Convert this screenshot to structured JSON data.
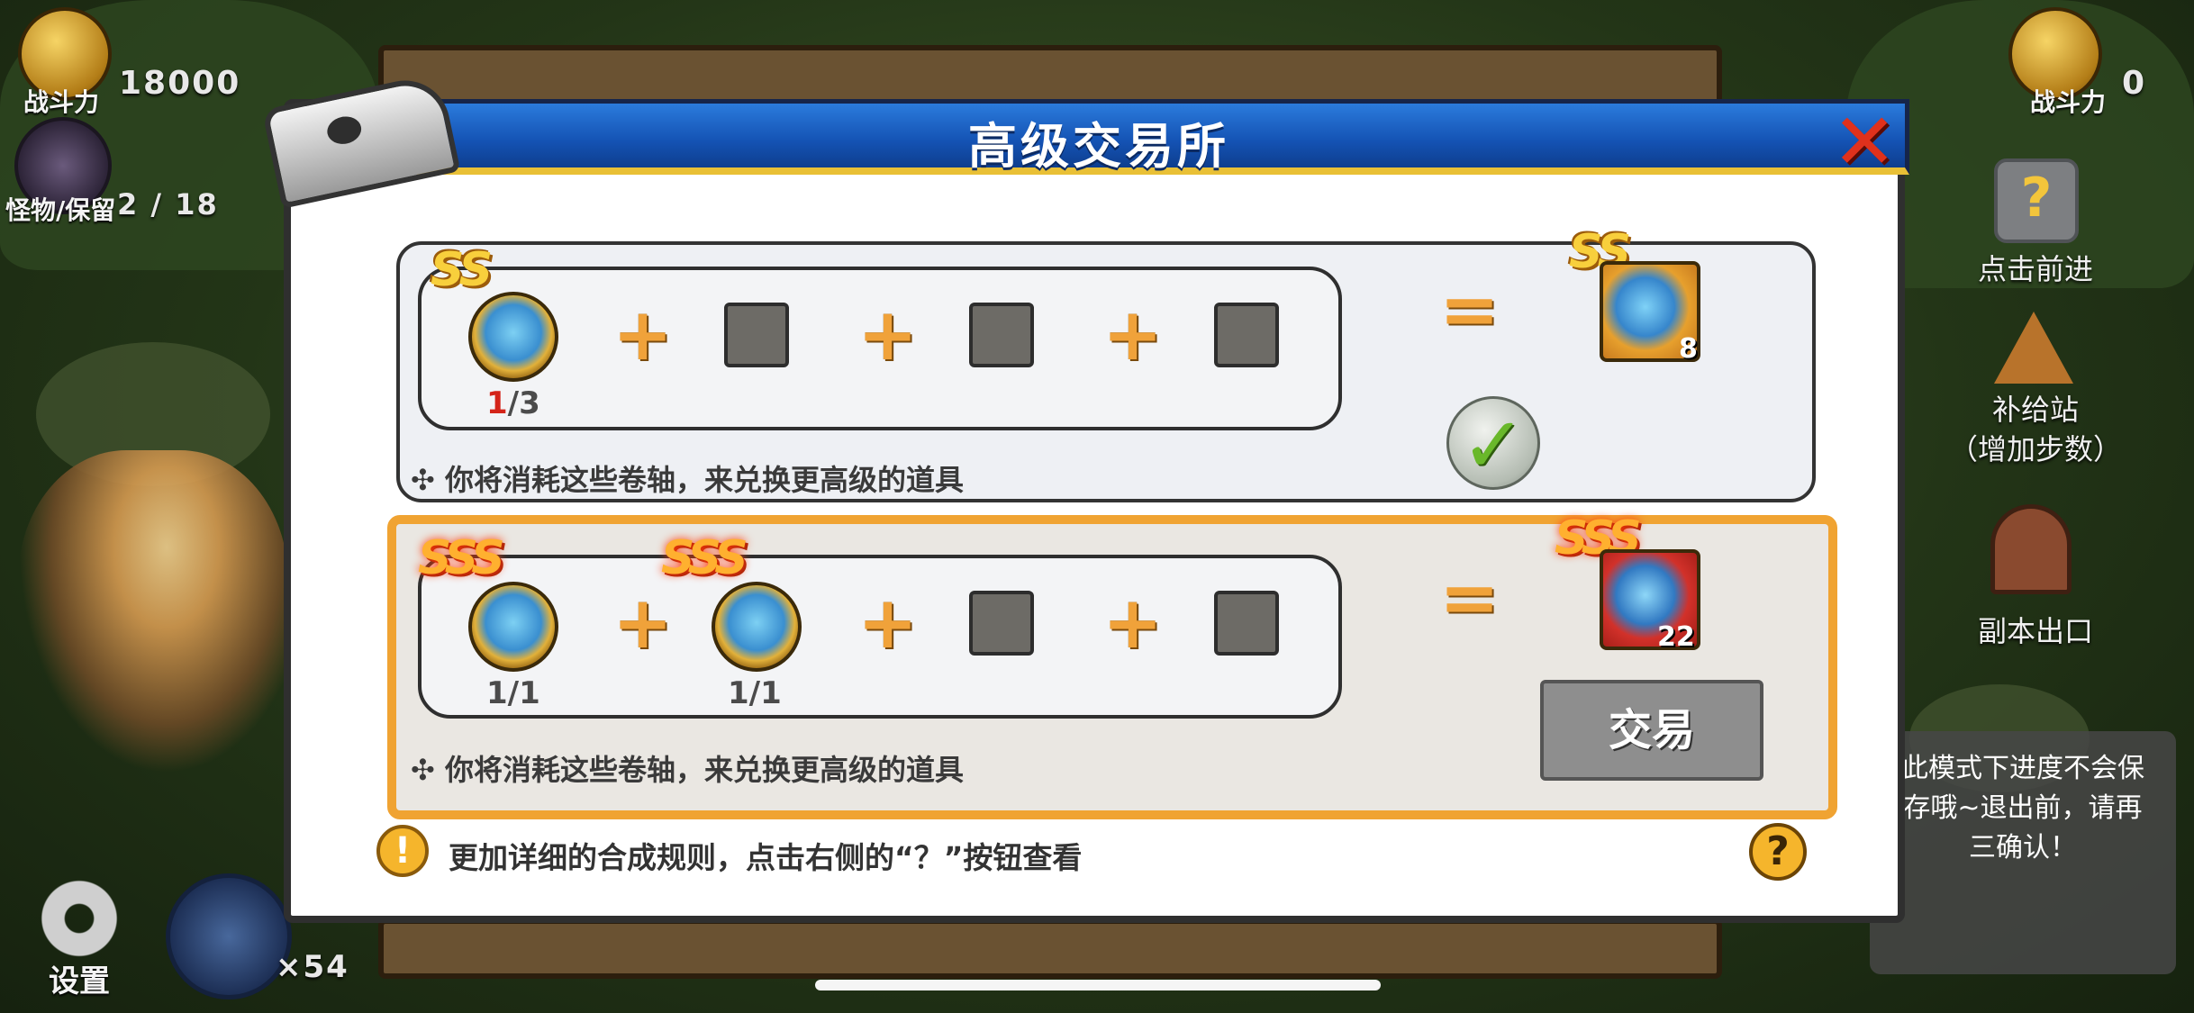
{
  "hud_left": {
    "power_label": "战斗力",
    "power_value": "18000",
    "monster_label": "怪物/保留",
    "monster_value": "2 / 18"
  },
  "hud_right": {
    "power_label": "战斗力",
    "power_value": "0",
    "advance_label": "点击前进",
    "supply_label": "补给站",
    "supply_sub": "（增加步数）",
    "exit_label": "副本出口",
    "notice": "此模式下进度不会保存哦~退出前，请再三确认！"
  },
  "bottom_hud": {
    "settings_label": "设置",
    "hero_count": "×54"
  },
  "dialog": {
    "title": "高级交易所",
    "row1": {
      "grade": "SS",
      "count_current": "1",
      "count_total": "/3",
      "reward_grade": "SS",
      "reward_count": "8",
      "description": "你将消耗这些卷轴，来兑换更高级的道具"
    },
    "row2": {
      "grade_a": "SSS",
      "grade_b": "SSS",
      "count_a": "1/1",
      "count_b": "1/1",
      "reward_grade": "SSS",
      "reward_count": "22",
      "description": "你将消耗这些卷轴，来兑换更高级的道具",
      "trade_label": "交易"
    },
    "footer_text": "更加详细的合成规则，点击右侧的“？”按钮查看",
    "help_symbol": "?",
    "info_symbol": "!"
  },
  "colors": {
    "title_bar": "#1452b3",
    "accent_gold": "#f0a332",
    "plus_orange": "#f0a23a",
    "close_red": "#e0311c"
  },
  "icons": [
    "power-badge-icon",
    "monster-icon",
    "question-block-icon",
    "tent-icon",
    "door-icon",
    "gear-icon",
    "hero-icon",
    "close-icon",
    "check-icon",
    "info-icon",
    "help-icon",
    "scroll-icon",
    "reward-card-icon"
  ]
}
